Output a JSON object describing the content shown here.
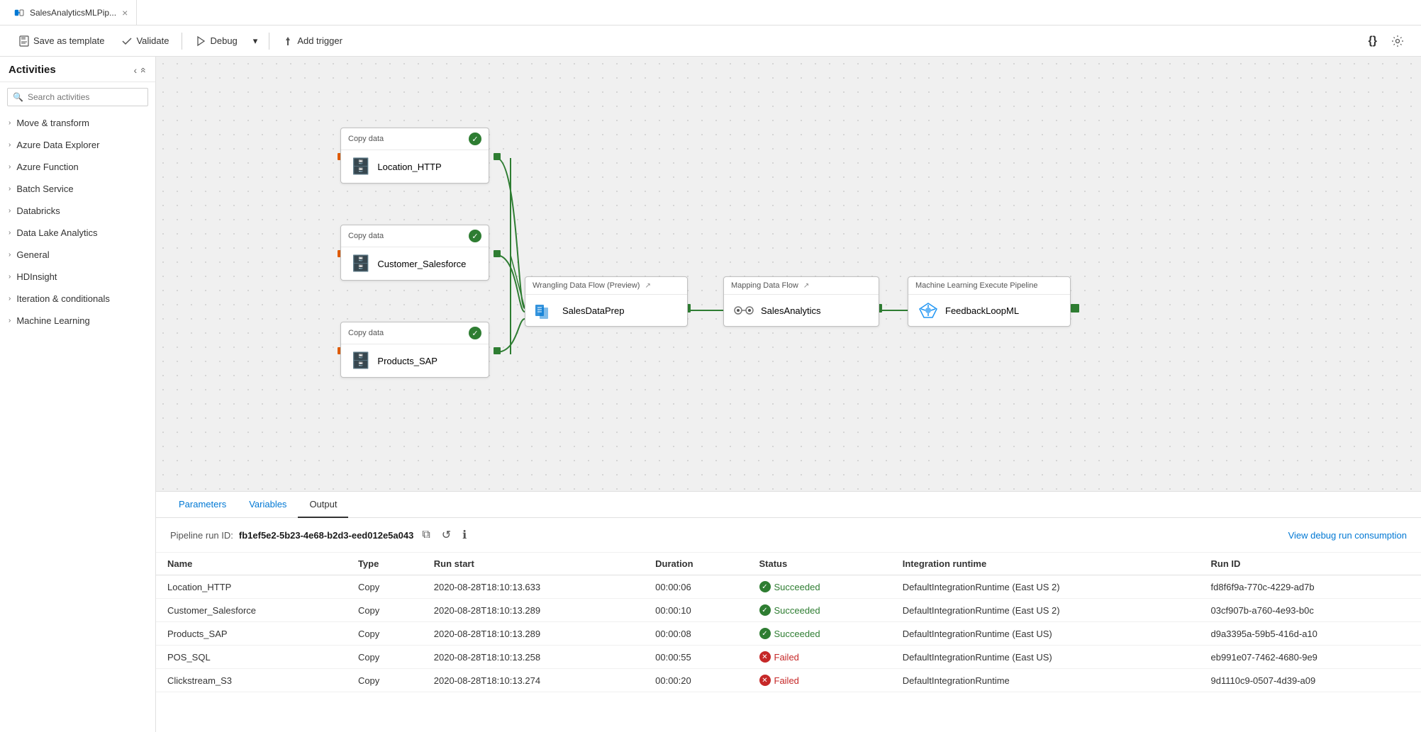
{
  "tab": {
    "icon": "pipeline-icon",
    "label": "SalesAnalyticsMLPip...",
    "close_label": "×"
  },
  "toolbar": {
    "save_template_label": "Save as template",
    "validate_label": "Validate",
    "debug_label": "Debug",
    "dropdown_label": "▾",
    "add_trigger_label": "Add trigger",
    "code_icon": "{}",
    "settings_icon": "⚙"
  },
  "sidebar": {
    "title": "Activities",
    "collapse_icon": "‹",
    "minimize_icon": "↑",
    "search_placeholder": "Search activities",
    "items": [
      {
        "label": "Move & transform"
      },
      {
        "label": "Azure Data Explorer"
      },
      {
        "label": "Azure Function"
      },
      {
        "label": "Batch Service"
      },
      {
        "label": "Databricks"
      },
      {
        "label": "Data Lake Analytics"
      },
      {
        "label": "General"
      },
      {
        "label": "HDInsight"
      },
      {
        "label": "Iteration & conditionals"
      },
      {
        "label": "Machine Learning"
      }
    ]
  },
  "nodes": {
    "copy1": {
      "header": "Copy data",
      "label": "Location_HTTP",
      "status": "success"
    },
    "copy2": {
      "header": "Copy data",
      "label": "Customer_Salesforce",
      "status": "success"
    },
    "copy3": {
      "header": "Copy data",
      "label": "Products_SAP",
      "status": "success"
    },
    "wrangling": {
      "header": "Wrangling Data Flow (Preview)",
      "label": "SalesDataPrep",
      "ext_link": "↗"
    },
    "mapping": {
      "header": "Mapping Data Flow",
      "label": "SalesAnalytics",
      "ext_link": "↗"
    },
    "ml": {
      "header": "Machine Learning Execute Pipeline",
      "label": "FeedbackLoopML"
    }
  },
  "output": {
    "tabs": [
      {
        "label": "Parameters"
      },
      {
        "label": "Variables"
      },
      {
        "label": "Output",
        "active": true
      }
    ],
    "pipeline_run_label": "Pipeline run ID:",
    "pipeline_run_id": "fb1ef5e2-5b23-4e68-b2d3-eed012e5a043",
    "view_debug_label": "View debug run consumption",
    "table_headers": [
      "Name",
      "Type",
      "Run start",
      "Duration",
      "Status",
      "Integration runtime",
      "Run ID"
    ],
    "rows": [
      {
        "name": "Location_HTTP",
        "type": "Copy",
        "run_start": "2020-08-28T18:10:13.633",
        "duration": "00:00:06",
        "status": "Succeeded",
        "status_type": "success",
        "integration_runtime": "DefaultIntegrationRuntime (East US 2)",
        "run_id": "fd8f6f9a-770c-4229-ad7b"
      },
      {
        "name": "Customer_Salesforce",
        "type": "Copy",
        "run_start": "2020-08-28T18:10:13.289",
        "duration": "00:00:10",
        "status": "Succeeded",
        "status_type": "success",
        "integration_runtime": "DefaultIntegrationRuntime (East US 2)",
        "run_id": "03cf907b-a760-4e93-b0c"
      },
      {
        "name": "Products_SAP",
        "type": "Copy",
        "run_start": "2020-08-28T18:10:13.289",
        "duration": "00:00:08",
        "status": "Succeeded",
        "status_type": "success",
        "integration_runtime": "DefaultIntegrationRuntime (East US)",
        "run_id": "d9a3395a-59b5-416d-a10"
      },
      {
        "name": "POS_SQL",
        "type": "Copy",
        "run_start": "2020-08-28T18:10:13.258",
        "duration": "00:00:55",
        "status": "Failed",
        "status_type": "failed",
        "integration_runtime": "DefaultIntegrationRuntime (East US)",
        "run_id": "eb991e07-7462-4680-9e9"
      },
      {
        "name": "Clickstream_S3",
        "type": "Copy",
        "run_start": "2020-08-28T18:10:13.274",
        "duration": "00:00:20",
        "status": "Failed",
        "status_type": "failed",
        "integration_runtime": "DefaultIntegrationRuntime",
        "run_id": "9d1110c9-0507-4d39-a09"
      }
    ]
  }
}
